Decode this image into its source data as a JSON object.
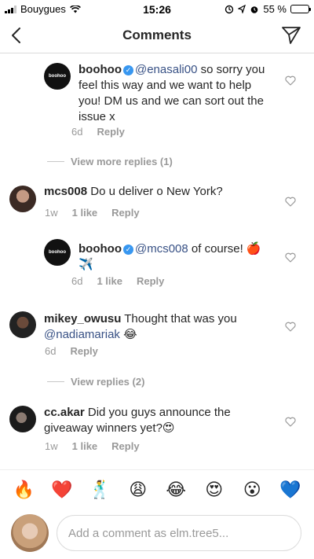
{
  "status_bar": {
    "carrier": "Bouygues",
    "time": "15:26",
    "battery": "55 %",
    "battery_fraction": 0.55
  },
  "header": {
    "title": "Comments"
  },
  "comments": [
    {
      "username": "boohoo",
      "avatar_text": "boohoo",
      "mention": "@enasali00",
      "text": " so sorry you feel this way and we want to help you! DM us and we can sort out the issue x",
      "time": "6d",
      "reply": "Reply"
    },
    {
      "username": "mcs008",
      "text": " Do u deliver o New York?",
      "time": "1w",
      "likes": "1 like",
      "reply": "Reply"
    },
    {
      "username": "boohoo",
      "avatar_text": "boohoo",
      "mention": "@mcs008",
      "text": " of course! 🍎 ✈️",
      "time": "6d",
      "likes": "1 like",
      "reply": "Reply"
    },
    {
      "username": "mikey_owusu",
      "text": " Thought that was you ",
      "mention": "@nadiamariak",
      "emoji": " 😂",
      "time": "6d",
      "reply": "Reply"
    },
    {
      "username": "cc.akar",
      "text": " Did you guys announce the giveaway winners yet?😍",
      "time": "1w",
      "likes": "1 like",
      "reply": "Reply"
    }
  ],
  "view_more_replies": "View more replies (1)",
  "view_replies": "View replies (2)",
  "emoji_bar": [
    "🔥",
    "❤️",
    "🕺",
    "😩",
    "😂",
    "😍",
    "😮",
    "💙"
  ],
  "composer": {
    "placeholder": "Add a comment as elm.tree5..."
  },
  "colors": {
    "mention": "#385185",
    "verified": "#3897f0",
    "muted": "#999999"
  }
}
